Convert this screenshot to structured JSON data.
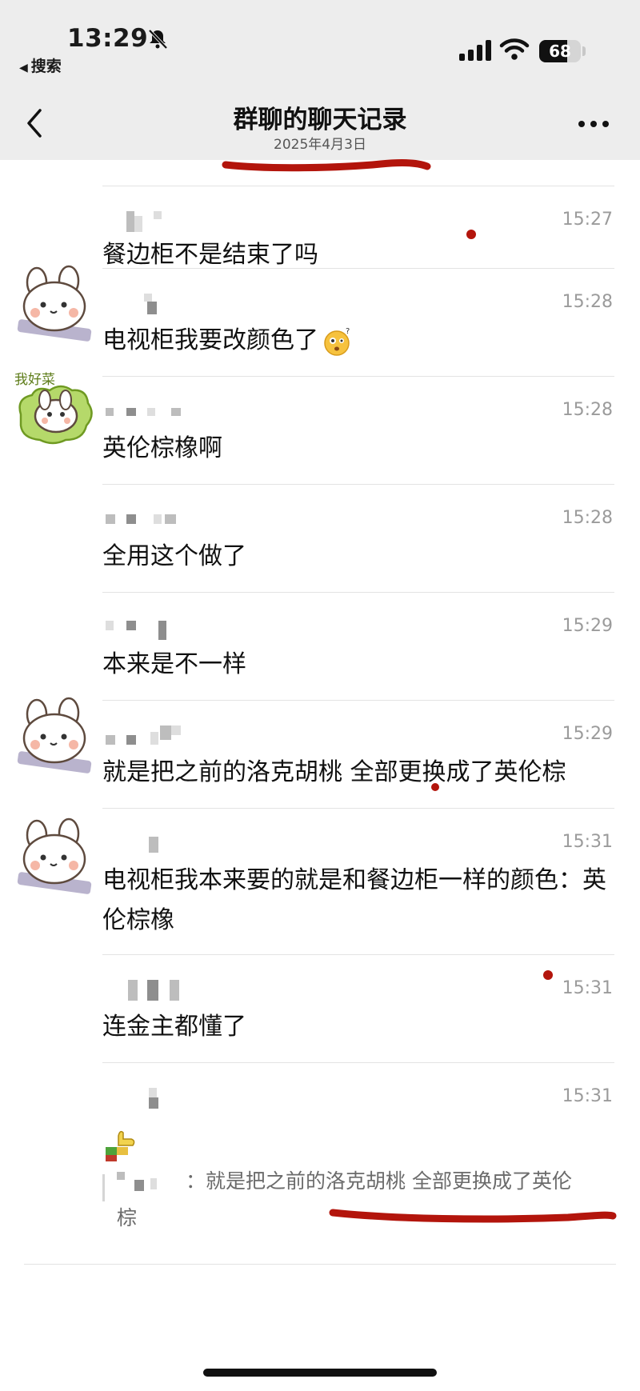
{
  "status_bar": {
    "time": "13:29",
    "back_app": "搜索",
    "battery": "68",
    "battery_level": 0.68
  },
  "nav": {
    "title": "群聊的聊天记录",
    "date": "2025年4月3日"
  },
  "messages": [
    {
      "time": "15:27",
      "text": "餐边柜不是结束了吗"
    },
    {
      "time": "15:28",
      "text": "电视柜我要改颜色了"
    },
    {
      "time": "15:28",
      "text": "英伦棕橡啊"
    },
    {
      "time": "15:28",
      "text": "全用这个做了"
    },
    {
      "time": "15:29",
      "text": "本来是不一样"
    },
    {
      "time": "15:29",
      "text": "就是把之前的洛克胡桃 全部更换成了英伦棕"
    },
    {
      "time": "15:31",
      "text": "电视柜我本来要的就是和餐边柜一样的颜色：英伦棕橡"
    },
    {
      "time": "15:31",
      "text": "连金主都懂了"
    },
    {
      "time": "15:31",
      "quote_prefix": "：",
      "quote_text": "就是把之前的洛克胡桃 全部更换成了英伦",
      "quote_text_2": "棕"
    }
  ],
  "avatar_caption": "我好菜",
  "colors": {
    "header_bg": "#ededed",
    "annotation_red": "#b3150c",
    "time_gray": "#9b9b9b"
  }
}
